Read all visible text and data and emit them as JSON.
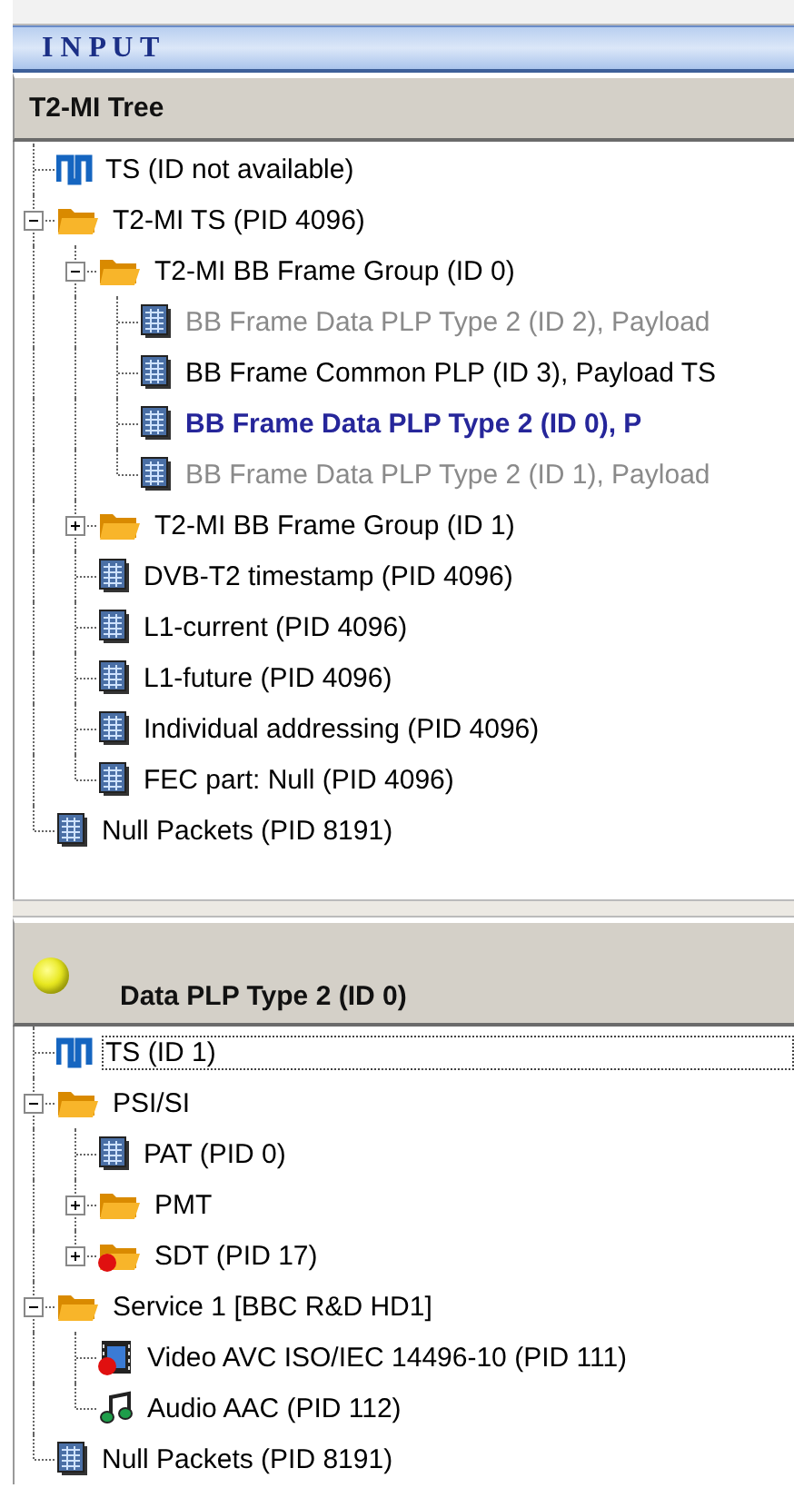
{
  "header": {
    "title": "I N P U T"
  },
  "panels": [
    {
      "title": "T2-MI Tree",
      "tree": [
        {
          "label": "TS (ID not available)",
          "kind": "ts",
          "selected": false,
          "disabled": false
        },
        {
          "label": "T2-MI TS (PID 4096)",
          "kind": "folder",
          "expanded": true,
          "selected": false,
          "disabled": false,
          "children": [
            {
              "label": "T2-MI BB Frame Group (ID 0)",
              "kind": "folder",
              "expanded": true,
              "selected": false,
              "disabled": false,
              "children": [
                {
                  "label": "BB Frame Data PLP Type 2 (ID 2), Payload",
                  "kind": "table",
                  "selected": false,
                  "disabled": true
                },
                {
                  "label": "BB Frame Common PLP (ID 3), Payload TS",
                  "kind": "table",
                  "selected": false,
                  "disabled": false
                },
                {
                  "label": "BB Frame Data PLP Type 2 (ID 0), P",
                  "kind": "table",
                  "selected": true,
                  "disabled": false
                },
                {
                  "label": "BB Frame Data PLP Type 2 (ID 1), Payload",
                  "kind": "table",
                  "selected": false,
                  "disabled": true
                }
              ]
            },
            {
              "label": "T2-MI BB Frame Group (ID 1)",
              "kind": "folder",
              "expanded": false,
              "selected": false,
              "disabled": false
            },
            {
              "label": "DVB-T2 timestamp (PID 4096)",
              "kind": "table",
              "selected": false,
              "disabled": false
            },
            {
              "label": "L1-current (PID 4096)",
              "kind": "table",
              "selected": false,
              "disabled": false
            },
            {
              "label": "L1-future (PID 4096)",
              "kind": "table",
              "selected": false,
              "disabled": false
            },
            {
              "label": "Individual addressing (PID 4096)",
              "kind": "table",
              "selected": false,
              "disabled": false
            },
            {
              "label": "FEC part: Null (PID 4096)",
              "kind": "table",
              "selected": false,
              "disabled": false
            }
          ]
        },
        {
          "label": "Null Packets (PID 8191)",
          "kind": "table",
          "selected": false,
          "disabled": false
        }
      ]
    },
    {
      "title": "Data PLP Type 2 (ID 0)",
      "indicator_on": true,
      "tree": [
        {
          "label": "TS (ID 1)",
          "kind": "ts",
          "focused": true,
          "alarm": false
        },
        {
          "label": "PSI/SI",
          "kind": "folder",
          "expanded": true,
          "focused": false,
          "alarm": false,
          "children": [
            {
              "label": "PAT (PID 0)",
              "kind": "table",
              "focused": false,
              "alarm": false
            },
            {
              "label": "PMT",
              "kind": "folder",
              "expanded": false,
              "focused": false,
              "alarm": false
            },
            {
              "label": "SDT (PID 17)",
              "kind": "folder",
              "expanded": false,
              "focused": false,
              "alarm": true
            }
          ]
        },
        {
          "label": "Service 1 [BBC R&D HD1]",
          "kind": "folder",
          "expanded": true,
          "focused": false,
          "alarm": false,
          "children": [
            {
              "label": "Video AVC ISO/IEC 14496-10 (PID 111)",
              "kind": "video",
              "focused": false,
              "alarm": true
            },
            {
              "label": "Audio AAC (PID 112)",
              "kind": "audio",
              "focused": false,
              "alarm": false
            }
          ]
        },
        {
          "label": "Null Packets (PID 8191)",
          "kind": "table",
          "focused": false,
          "alarm": false
        }
      ]
    }
  ]
}
